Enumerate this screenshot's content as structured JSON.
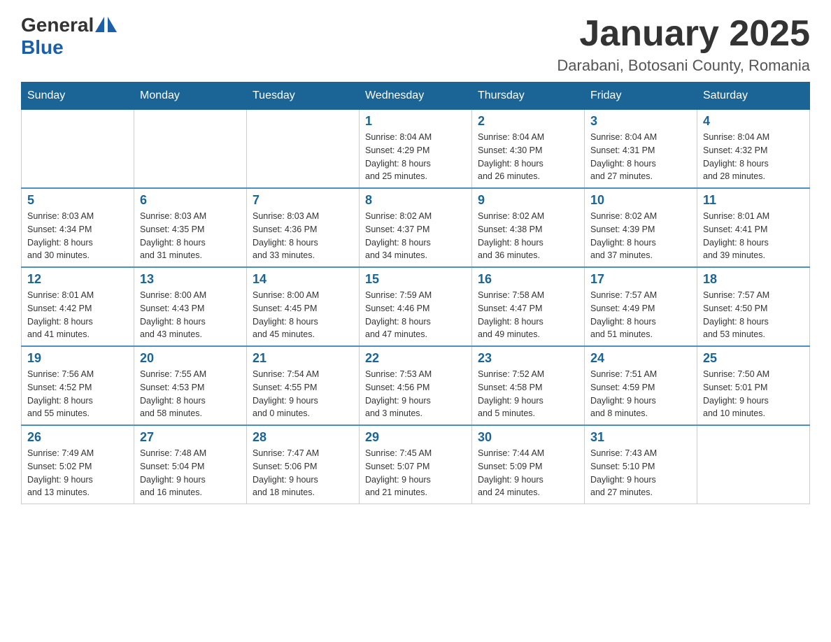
{
  "header": {
    "logo": {
      "general": "General",
      "blue": "Blue"
    },
    "title": "January 2025",
    "location": "Darabani, Botosani County, Romania"
  },
  "columns": [
    "Sunday",
    "Monday",
    "Tuesday",
    "Wednesday",
    "Thursday",
    "Friday",
    "Saturday"
  ],
  "weeks": [
    [
      {
        "day": "",
        "info": ""
      },
      {
        "day": "",
        "info": ""
      },
      {
        "day": "",
        "info": ""
      },
      {
        "day": "1",
        "info": "Sunrise: 8:04 AM\nSunset: 4:29 PM\nDaylight: 8 hours\nand 25 minutes."
      },
      {
        "day": "2",
        "info": "Sunrise: 8:04 AM\nSunset: 4:30 PM\nDaylight: 8 hours\nand 26 minutes."
      },
      {
        "day": "3",
        "info": "Sunrise: 8:04 AM\nSunset: 4:31 PM\nDaylight: 8 hours\nand 27 minutes."
      },
      {
        "day": "4",
        "info": "Sunrise: 8:04 AM\nSunset: 4:32 PM\nDaylight: 8 hours\nand 28 minutes."
      }
    ],
    [
      {
        "day": "5",
        "info": "Sunrise: 8:03 AM\nSunset: 4:34 PM\nDaylight: 8 hours\nand 30 minutes."
      },
      {
        "day": "6",
        "info": "Sunrise: 8:03 AM\nSunset: 4:35 PM\nDaylight: 8 hours\nand 31 minutes."
      },
      {
        "day": "7",
        "info": "Sunrise: 8:03 AM\nSunset: 4:36 PM\nDaylight: 8 hours\nand 33 minutes."
      },
      {
        "day": "8",
        "info": "Sunrise: 8:02 AM\nSunset: 4:37 PM\nDaylight: 8 hours\nand 34 minutes."
      },
      {
        "day": "9",
        "info": "Sunrise: 8:02 AM\nSunset: 4:38 PM\nDaylight: 8 hours\nand 36 minutes."
      },
      {
        "day": "10",
        "info": "Sunrise: 8:02 AM\nSunset: 4:39 PM\nDaylight: 8 hours\nand 37 minutes."
      },
      {
        "day": "11",
        "info": "Sunrise: 8:01 AM\nSunset: 4:41 PM\nDaylight: 8 hours\nand 39 minutes."
      }
    ],
    [
      {
        "day": "12",
        "info": "Sunrise: 8:01 AM\nSunset: 4:42 PM\nDaylight: 8 hours\nand 41 minutes."
      },
      {
        "day": "13",
        "info": "Sunrise: 8:00 AM\nSunset: 4:43 PM\nDaylight: 8 hours\nand 43 minutes."
      },
      {
        "day": "14",
        "info": "Sunrise: 8:00 AM\nSunset: 4:45 PM\nDaylight: 8 hours\nand 45 minutes."
      },
      {
        "day": "15",
        "info": "Sunrise: 7:59 AM\nSunset: 4:46 PM\nDaylight: 8 hours\nand 47 minutes."
      },
      {
        "day": "16",
        "info": "Sunrise: 7:58 AM\nSunset: 4:47 PM\nDaylight: 8 hours\nand 49 minutes."
      },
      {
        "day": "17",
        "info": "Sunrise: 7:57 AM\nSunset: 4:49 PM\nDaylight: 8 hours\nand 51 minutes."
      },
      {
        "day": "18",
        "info": "Sunrise: 7:57 AM\nSunset: 4:50 PM\nDaylight: 8 hours\nand 53 minutes."
      }
    ],
    [
      {
        "day": "19",
        "info": "Sunrise: 7:56 AM\nSunset: 4:52 PM\nDaylight: 8 hours\nand 55 minutes."
      },
      {
        "day": "20",
        "info": "Sunrise: 7:55 AM\nSunset: 4:53 PM\nDaylight: 8 hours\nand 58 minutes."
      },
      {
        "day": "21",
        "info": "Sunrise: 7:54 AM\nSunset: 4:55 PM\nDaylight: 9 hours\nand 0 minutes."
      },
      {
        "day": "22",
        "info": "Sunrise: 7:53 AM\nSunset: 4:56 PM\nDaylight: 9 hours\nand 3 minutes."
      },
      {
        "day": "23",
        "info": "Sunrise: 7:52 AM\nSunset: 4:58 PM\nDaylight: 9 hours\nand 5 minutes."
      },
      {
        "day": "24",
        "info": "Sunrise: 7:51 AM\nSunset: 4:59 PM\nDaylight: 9 hours\nand 8 minutes."
      },
      {
        "day": "25",
        "info": "Sunrise: 7:50 AM\nSunset: 5:01 PM\nDaylight: 9 hours\nand 10 minutes."
      }
    ],
    [
      {
        "day": "26",
        "info": "Sunrise: 7:49 AM\nSunset: 5:02 PM\nDaylight: 9 hours\nand 13 minutes."
      },
      {
        "day": "27",
        "info": "Sunrise: 7:48 AM\nSunset: 5:04 PM\nDaylight: 9 hours\nand 16 minutes."
      },
      {
        "day": "28",
        "info": "Sunrise: 7:47 AM\nSunset: 5:06 PM\nDaylight: 9 hours\nand 18 minutes."
      },
      {
        "day": "29",
        "info": "Sunrise: 7:45 AM\nSunset: 5:07 PM\nDaylight: 9 hours\nand 21 minutes."
      },
      {
        "day": "30",
        "info": "Sunrise: 7:44 AM\nSunset: 5:09 PM\nDaylight: 9 hours\nand 24 minutes."
      },
      {
        "day": "31",
        "info": "Sunrise: 7:43 AM\nSunset: 5:10 PM\nDaylight: 9 hours\nand 27 minutes."
      },
      {
        "day": "",
        "info": ""
      }
    ]
  ]
}
